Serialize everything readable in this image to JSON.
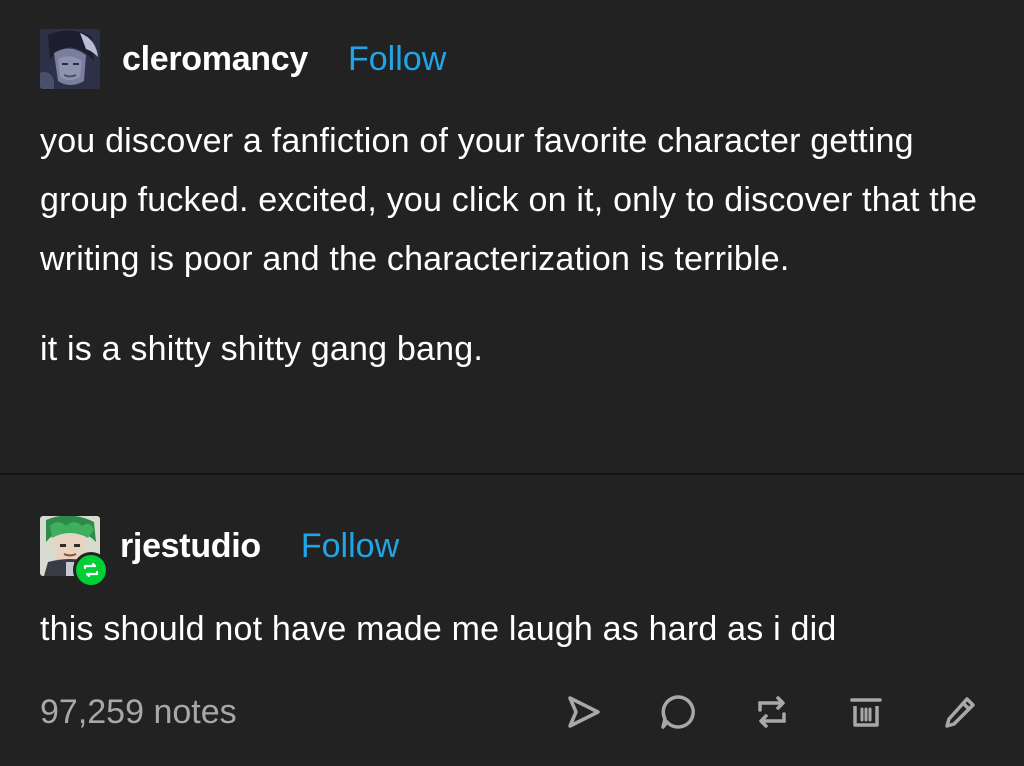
{
  "colors": {
    "background": "#222222",
    "text": "#ffffff",
    "follow_link": "#1fa5e8",
    "notes": "#a8a8a8",
    "reblog_badge": "#00cf35",
    "icon": "#a8a8a8"
  },
  "original_post": {
    "username": "cleromancy",
    "follow_label": "Follow",
    "avatar_icon": "user-avatar-icon",
    "paragraphs": [
      "you discover a fanfiction of your favorite character getting group fucked. excited, you click on it, only to discover that the writing is poor and the characterization is terrible.",
      "it is a shitty shitty gang bang."
    ]
  },
  "reblog": {
    "username": "rjestudio",
    "follow_label": "Follow",
    "avatar_icon": "user-avatar-icon",
    "badge_icon": "reblog-icon",
    "text": "this should not have made me laugh as hard as i did"
  },
  "footer": {
    "notes": "97,259 notes",
    "actions": [
      {
        "name": "share-icon"
      },
      {
        "name": "reply-icon"
      },
      {
        "name": "reblog-icon"
      },
      {
        "name": "delete-icon"
      },
      {
        "name": "edit-icon"
      }
    ]
  }
}
